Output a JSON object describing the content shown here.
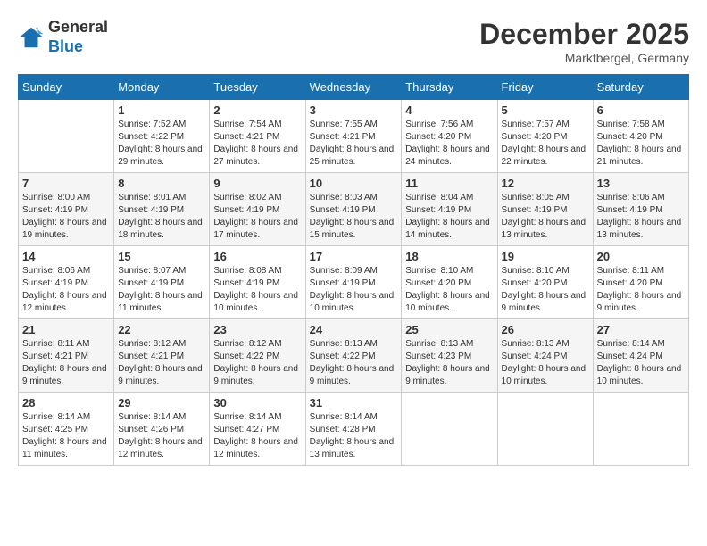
{
  "header": {
    "logo_line1": "General",
    "logo_line2": "Blue",
    "month": "December 2025",
    "location": "Marktbergel, Germany"
  },
  "weekdays": [
    "Sunday",
    "Monday",
    "Tuesday",
    "Wednesday",
    "Thursday",
    "Friday",
    "Saturday"
  ],
  "weeks": [
    [
      {
        "day": "",
        "sunrise": "",
        "sunset": "",
        "daylight": ""
      },
      {
        "day": "1",
        "sunrise": "Sunrise: 7:52 AM",
        "sunset": "Sunset: 4:22 PM",
        "daylight": "Daylight: 8 hours and 29 minutes."
      },
      {
        "day": "2",
        "sunrise": "Sunrise: 7:54 AM",
        "sunset": "Sunset: 4:21 PM",
        "daylight": "Daylight: 8 hours and 27 minutes."
      },
      {
        "day": "3",
        "sunrise": "Sunrise: 7:55 AM",
        "sunset": "Sunset: 4:21 PM",
        "daylight": "Daylight: 8 hours and 25 minutes."
      },
      {
        "day": "4",
        "sunrise": "Sunrise: 7:56 AM",
        "sunset": "Sunset: 4:20 PM",
        "daylight": "Daylight: 8 hours and 24 minutes."
      },
      {
        "day": "5",
        "sunrise": "Sunrise: 7:57 AM",
        "sunset": "Sunset: 4:20 PM",
        "daylight": "Daylight: 8 hours and 22 minutes."
      },
      {
        "day": "6",
        "sunrise": "Sunrise: 7:58 AM",
        "sunset": "Sunset: 4:20 PM",
        "daylight": "Daylight: 8 hours and 21 minutes."
      }
    ],
    [
      {
        "day": "7",
        "sunrise": "Sunrise: 8:00 AM",
        "sunset": "Sunset: 4:19 PM",
        "daylight": "Daylight: 8 hours and 19 minutes."
      },
      {
        "day": "8",
        "sunrise": "Sunrise: 8:01 AM",
        "sunset": "Sunset: 4:19 PM",
        "daylight": "Daylight: 8 hours and 18 minutes."
      },
      {
        "day": "9",
        "sunrise": "Sunrise: 8:02 AM",
        "sunset": "Sunset: 4:19 PM",
        "daylight": "Daylight: 8 hours and 17 minutes."
      },
      {
        "day": "10",
        "sunrise": "Sunrise: 8:03 AM",
        "sunset": "Sunset: 4:19 PM",
        "daylight": "Daylight: 8 hours and 15 minutes."
      },
      {
        "day": "11",
        "sunrise": "Sunrise: 8:04 AM",
        "sunset": "Sunset: 4:19 PM",
        "daylight": "Daylight: 8 hours and 14 minutes."
      },
      {
        "day": "12",
        "sunrise": "Sunrise: 8:05 AM",
        "sunset": "Sunset: 4:19 PM",
        "daylight": "Daylight: 8 hours and 13 minutes."
      },
      {
        "day": "13",
        "sunrise": "Sunrise: 8:06 AM",
        "sunset": "Sunset: 4:19 PM",
        "daylight": "Daylight: 8 hours and 13 minutes."
      }
    ],
    [
      {
        "day": "14",
        "sunrise": "Sunrise: 8:06 AM",
        "sunset": "Sunset: 4:19 PM",
        "daylight": "Daylight: 8 hours and 12 minutes."
      },
      {
        "day": "15",
        "sunrise": "Sunrise: 8:07 AM",
        "sunset": "Sunset: 4:19 PM",
        "daylight": "Daylight: 8 hours and 11 minutes."
      },
      {
        "day": "16",
        "sunrise": "Sunrise: 8:08 AM",
        "sunset": "Sunset: 4:19 PM",
        "daylight": "Daylight: 8 hours and 10 minutes."
      },
      {
        "day": "17",
        "sunrise": "Sunrise: 8:09 AM",
        "sunset": "Sunset: 4:19 PM",
        "daylight": "Daylight: 8 hours and 10 minutes."
      },
      {
        "day": "18",
        "sunrise": "Sunrise: 8:10 AM",
        "sunset": "Sunset: 4:20 PM",
        "daylight": "Daylight: 8 hours and 10 minutes."
      },
      {
        "day": "19",
        "sunrise": "Sunrise: 8:10 AM",
        "sunset": "Sunset: 4:20 PM",
        "daylight": "Daylight: 8 hours and 9 minutes."
      },
      {
        "day": "20",
        "sunrise": "Sunrise: 8:11 AM",
        "sunset": "Sunset: 4:20 PM",
        "daylight": "Daylight: 8 hours and 9 minutes."
      }
    ],
    [
      {
        "day": "21",
        "sunrise": "Sunrise: 8:11 AM",
        "sunset": "Sunset: 4:21 PM",
        "daylight": "Daylight: 8 hours and 9 minutes."
      },
      {
        "day": "22",
        "sunrise": "Sunrise: 8:12 AM",
        "sunset": "Sunset: 4:21 PM",
        "daylight": "Daylight: 8 hours and 9 minutes."
      },
      {
        "day": "23",
        "sunrise": "Sunrise: 8:12 AM",
        "sunset": "Sunset: 4:22 PM",
        "daylight": "Daylight: 8 hours and 9 minutes."
      },
      {
        "day": "24",
        "sunrise": "Sunrise: 8:13 AM",
        "sunset": "Sunset: 4:22 PM",
        "daylight": "Daylight: 8 hours and 9 minutes."
      },
      {
        "day": "25",
        "sunrise": "Sunrise: 8:13 AM",
        "sunset": "Sunset: 4:23 PM",
        "daylight": "Daylight: 8 hours and 9 minutes."
      },
      {
        "day": "26",
        "sunrise": "Sunrise: 8:13 AM",
        "sunset": "Sunset: 4:24 PM",
        "daylight": "Daylight: 8 hours and 10 minutes."
      },
      {
        "day": "27",
        "sunrise": "Sunrise: 8:14 AM",
        "sunset": "Sunset: 4:24 PM",
        "daylight": "Daylight: 8 hours and 10 minutes."
      }
    ],
    [
      {
        "day": "28",
        "sunrise": "Sunrise: 8:14 AM",
        "sunset": "Sunset: 4:25 PM",
        "daylight": "Daylight: 8 hours and 11 minutes."
      },
      {
        "day": "29",
        "sunrise": "Sunrise: 8:14 AM",
        "sunset": "Sunset: 4:26 PM",
        "daylight": "Daylight: 8 hours and 12 minutes."
      },
      {
        "day": "30",
        "sunrise": "Sunrise: 8:14 AM",
        "sunset": "Sunset: 4:27 PM",
        "daylight": "Daylight: 8 hours and 12 minutes."
      },
      {
        "day": "31",
        "sunrise": "Sunrise: 8:14 AM",
        "sunset": "Sunset: 4:28 PM",
        "daylight": "Daylight: 8 hours and 13 minutes."
      },
      {
        "day": "",
        "sunrise": "",
        "sunset": "",
        "daylight": ""
      },
      {
        "day": "",
        "sunrise": "",
        "sunset": "",
        "daylight": ""
      },
      {
        "day": "",
        "sunrise": "",
        "sunset": "",
        "daylight": ""
      }
    ]
  ]
}
